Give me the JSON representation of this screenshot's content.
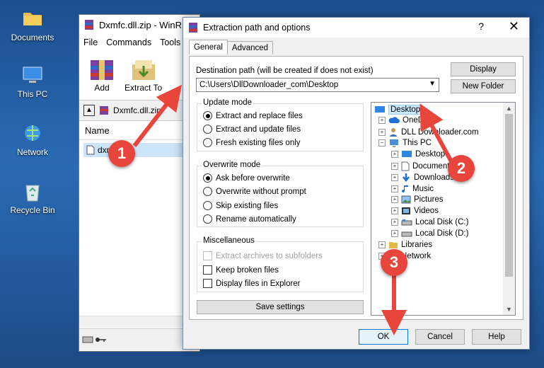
{
  "desktop": {
    "icons": [
      {
        "label": "Documents"
      },
      {
        "label": "This PC"
      },
      {
        "label": "Network"
      },
      {
        "label": "Recycle Bin"
      }
    ]
  },
  "winrar": {
    "title": "Dxmfc.dll.zip - WinR",
    "menu": [
      "File",
      "Commands",
      "Tools"
    ],
    "tools": [
      {
        "label": "Add"
      },
      {
        "label": "Extract To"
      }
    ],
    "path_text": "Dxmfc.dll.zip",
    "column_name": "Name",
    "file_name": "dxmfc.dll"
  },
  "dialog": {
    "title": "Extraction path and options",
    "help": "?",
    "close": "✕",
    "tabs": [
      "General",
      "Advanced"
    ],
    "dest_label": "Destination path (will be created if does not exist)",
    "dest_value": "C:\\Users\\DllDownloader_com\\Desktop",
    "display_btn": "Display",
    "newfolder_btn": "New Folder",
    "update_mode": {
      "title": "Update mode",
      "options": [
        "Extract and replace files",
        "Extract and update files",
        "Fresh existing files only"
      ],
      "selected": 0
    },
    "overwrite_mode": {
      "title": "Overwrite mode",
      "options": [
        "Ask before overwrite",
        "Overwrite without prompt",
        "Skip existing files",
        "Rename automatically"
      ],
      "selected": 0
    },
    "misc": {
      "title": "Miscellaneous",
      "options": [
        "Extract archives to subfolders",
        "Keep broken files",
        "Display files in Explorer"
      ]
    },
    "save_settings": "Save settings",
    "tree": [
      "Desktop",
      "OneDrive",
      "DLL Downloader.com",
      "This PC",
      "Desktop",
      "Documents",
      "Downloads",
      "Music",
      "Pictures",
      "Videos",
      "Local Disk (C:)",
      "Local Disk (D:)",
      "Libraries",
      "Network"
    ],
    "ok": "OK",
    "cancel": "Cancel",
    "help_btn": "Help"
  },
  "callouts": [
    "1",
    "2",
    "3"
  ],
  "colors": {
    "callout": "#e8453c",
    "selection": "#cce8ff",
    "accent": "#0078d7"
  }
}
